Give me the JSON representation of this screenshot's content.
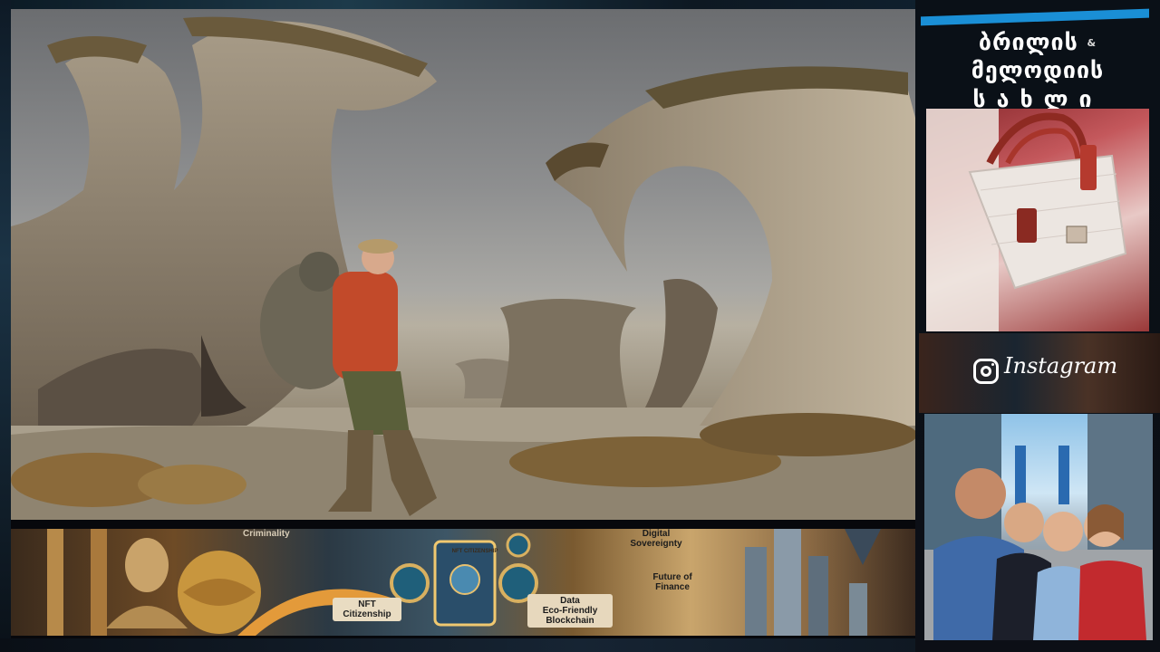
{
  "panel": {
    "brand_line1": "ბრილის",
    "brand_amp": "&",
    "brand_line1b": "მელოდიის",
    "brand_line2": "სახლი",
    "instagram_label": "Instagram"
  },
  "banner": {
    "labels": {
      "criminality": "Criminality",
      "card": "NFT CITIZENSHIP",
      "nft": "NFT\nCitizenship",
      "data": "Data\nEco-Friendly\nBlockchain",
      "digital": "Digital\nSovereignty",
      "future": "Future of\nFinance"
    }
  },
  "icons": {
    "instagram": "instagram-icon"
  },
  "colors": {
    "accent_blue": "#1a8fd6",
    "frame_dark": "#07080c",
    "jacket_red": "#c24a2a"
  }
}
